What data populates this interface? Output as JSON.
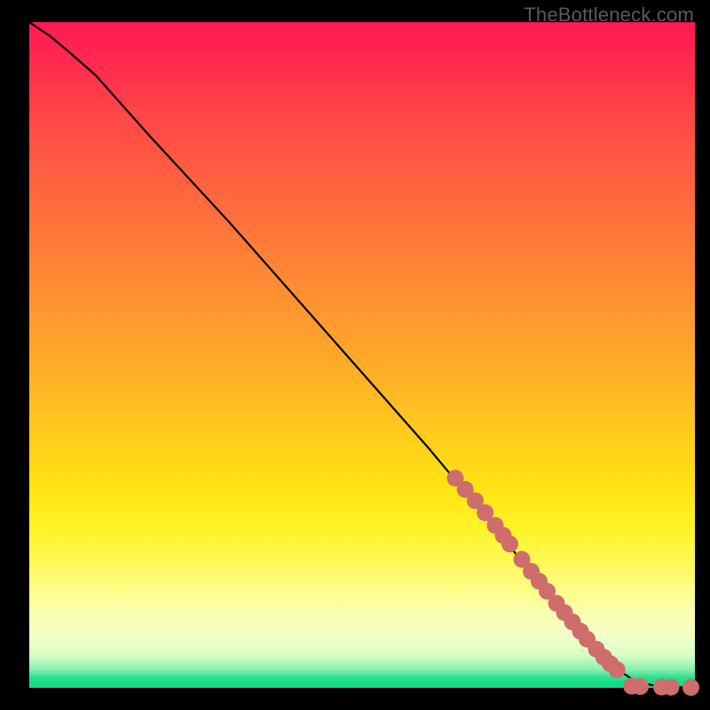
{
  "watermark": "TheBottleneck.com",
  "colors": {
    "dot": "#cf6d6d",
    "curve": "#000000"
  },
  "chart_data": {
    "type": "line",
    "title": "",
    "xlabel": "",
    "ylabel": "",
    "xlim": [
      0,
      100
    ],
    "ylim": [
      0,
      100
    ],
    "grid": false,
    "legend": false,
    "series": [
      {
        "name": "curve",
        "x": [
          0,
          3,
          6,
          10,
          18,
          30,
          45,
          60,
          70,
          78,
          84,
          88,
          91,
          94,
          97,
          100
        ],
        "y": [
          100,
          98,
          95.5,
          92,
          83,
          70,
          53,
          36,
          24,
          14,
          7,
          3,
          1,
          0.3,
          0.1,
          0.05
        ]
      }
    ],
    "dots_comment": "Salmon dots overlaid on the lower-right portion of the curve and along the bottom tail.",
    "dots": [
      {
        "x": 64,
        "y": 31.5
      },
      {
        "x": 65.5,
        "y": 29.8
      },
      {
        "x": 67,
        "y": 28.1
      },
      {
        "x": 68.5,
        "y": 26.3
      },
      {
        "x": 70,
        "y": 24.4
      },
      {
        "x": 71.2,
        "y": 22.9
      },
      {
        "x": 72.2,
        "y": 21.6
      },
      {
        "x": 74.0,
        "y": 19.3
      },
      {
        "x": 75.4,
        "y": 17.5
      },
      {
        "x": 76.6,
        "y": 16.0
      },
      {
        "x": 77.8,
        "y": 14.5
      },
      {
        "x": 79.2,
        "y": 12.7
      },
      {
        "x": 80.4,
        "y": 11.3
      },
      {
        "x": 81.6,
        "y": 9.9
      },
      {
        "x": 82.8,
        "y": 8.5
      },
      {
        "x": 83.8,
        "y": 7.3
      },
      {
        "x": 85.2,
        "y": 5.8
      },
      {
        "x": 86.3,
        "y": 4.6
      },
      {
        "x": 87.3,
        "y": 3.6
      },
      {
        "x": 88.3,
        "y": 2.7
      },
      {
        "x": 90.5,
        "y": 0.25
      },
      {
        "x": 91.8,
        "y": 0.2
      },
      {
        "x": 95.0,
        "y": 0.12
      },
      {
        "x": 96.4,
        "y": 0.1
      },
      {
        "x": 99.4,
        "y": 0.06
      }
    ]
  }
}
